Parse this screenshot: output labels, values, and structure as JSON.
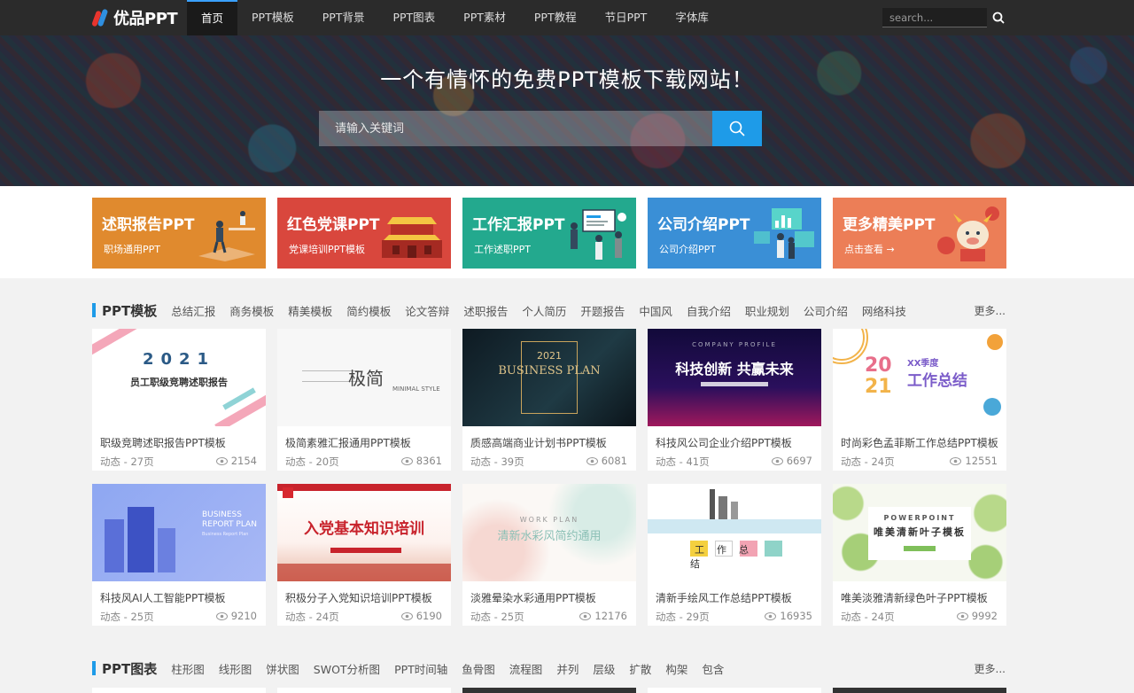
{
  "nav": {
    "logo_text": "优品PPT",
    "items": [
      "首页",
      "PPT模板",
      "PPT背景",
      "PPT图表",
      "PPT素材",
      "PPT教程",
      "节日PPT",
      "字体库"
    ],
    "search_placeholder": "search..."
  },
  "hero": {
    "title": "一个有情怀的免费PPT模板下载网站！",
    "search_placeholder": "请输入关键词"
  },
  "banners": [
    {
      "title": "述职报告PPT",
      "sub": "职场通用PPT",
      "color": "#e08a2e"
    },
    {
      "title": "红色党课PPT",
      "sub": "党课培训PPT模板",
      "color": "#d9473d"
    },
    {
      "title": "工作汇报PPT",
      "sub": "工作述职PPT",
      "color": "#23a98e"
    },
    {
      "title": "公司介绍PPT",
      "sub": "公司介绍PPT",
      "color": "#3a8fd6"
    },
    {
      "title": "更多精美PPT",
      "sub": "点击查看 →",
      "color": "#ec7e57"
    }
  ],
  "section1": {
    "title": "PPT模板",
    "tags": [
      "总结汇报",
      "商务模板",
      "精美模板",
      "简约模板",
      "论文答辩",
      "述职报告",
      "个人简历",
      "开题报告",
      "中国风",
      "自我介绍",
      "职业规划",
      "公司介绍",
      "网络科技"
    ],
    "more": "更多..."
  },
  "cards": [
    {
      "title": "职级竞聘述职报告PPT模板",
      "meta": "动态 - 27页",
      "views": "2154",
      "thumb_text": "2021",
      "thumb_sub": "员工职级竞聘述职报告"
    },
    {
      "title": "极简素雅汇报通用PPT模板",
      "meta": "动态 - 20页",
      "views": "8361",
      "thumb_text": "极简",
      "thumb_sub": "MINIMAL STYLE"
    },
    {
      "title": "质感高端商业计划书PPT模板",
      "meta": "动态 - 39页",
      "views": "6081",
      "thumb_text": "BUSINESS PLAN",
      "thumb_sub": "2021"
    },
    {
      "title": "科技风公司企业介绍PPT模板",
      "meta": "动态 - 41页",
      "views": "6697",
      "thumb_text": "科技创新 共赢未来",
      "thumb_sub": "COMPANY PROFILE"
    },
    {
      "title": "时尚彩色孟菲斯工作总结PPT模板",
      "meta": "动态 - 24页",
      "views": "12551",
      "thumb_text": "工作总结",
      "thumb_sub": "XX季度"
    },
    {
      "title": "科技风AI人工智能PPT模板",
      "meta": "动态 - 25页",
      "views": "9210",
      "thumb_text": "BUSINESS REPORT PLAN",
      "thumb_sub": "Business Report Plan"
    },
    {
      "title": "积极分子入党知识培训PPT模板",
      "meta": "动态 - 24页",
      "views": "6190",
      "thumb_text": "入党基本知识培训",
      "thumb_sub": ""
    },
    {
      "title": "淡雅晕染水彩通用PPT模板",
      "meta": "动态 - 25页",
      "views": "12176",
      "thumb_text": "清新水彩风简约通用",
      "thumb_sub": "WORK PLAN"
    },
    {
      "title": "清新手绘风工作总结PPT模板",
      "meta": "动态 - 29页",
      "views": "16935",
      "thumb_text": "工作总结",
      "thumb_sub": ""
    },
    {
      "title": "唯美淡雅清新绿色叶子PPT模板",
      "meta": "动态 - 24页",
      "views": "9992",
      "thumb_text": "唯美清新叶子模板",
      "thumb_sub": "POWERPOINT"
    }
  ],
  "section2": {
    "title": "PPT图表",
    "tags": [
      "柱形图",
      "线形图",
      "饼状图",
      "SWOT分析图",
      "PPT时间轴",
      "鱼骨图",
      "流程图",
      "并列",
      "层级",
      "扩散",
      "构架",
      "包含"
    ],
    "more": "更多..."
  }
}
